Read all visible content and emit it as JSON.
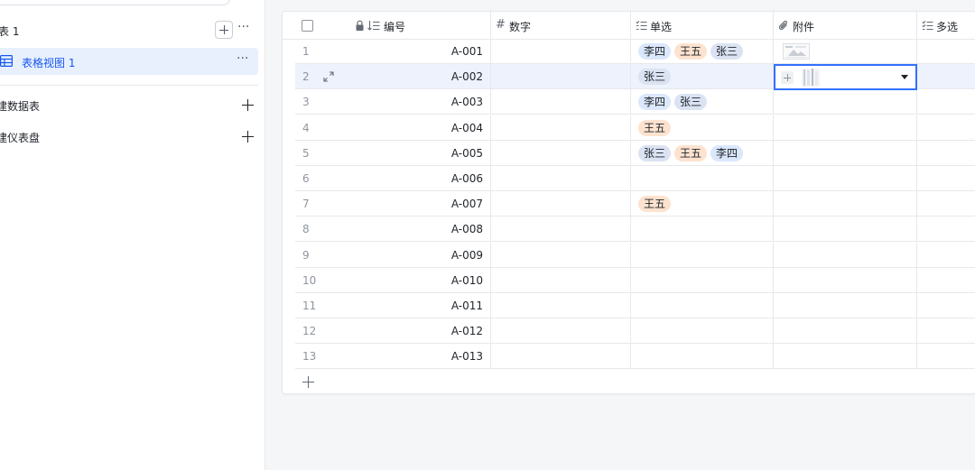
{
  "sidebar": {
    "table_label": "表 1",
    "more_glyph": "···",
    "view": {
      "label": "表格视图 1",
      "more_glyph": "···"
    },
    "actions": [
      {
        "label": "建数据表"
      },
      {
        "label": "建仪表盘"
      }
    ]
  },
  "grid": {
    "columns": [
      {
        "label": "编号",
        "icon": "lock-icon, sort-icon"
      },
      {
        "label": "数字",
        "icon": "hash-icon"
      },
      {
        "label": "单选",
        "icon": "single-select-icon"
      },
      {
        "label": "附件",
        "icon": "paperclip-icon"
      },
      {
        "label": "多选",
        "icon": "multi-select-icon"
      }
    ],
    "hash_glyph": "#",
    "rows": [
      {
        "num": "1",
        "code": "A-001",
        "tags": [
          "李四",
          "王五",
          "张三"
        ],
        "attachment": true
      },
      {
        "num": "2",
        "code": "A-002",
        "tags": [
          "张三"
        ],
        "selected": true
      },
      {
        "num": "3",
        "code": "A-003",
        "tags": [
          "李四",
          "张三"
        ]
      },
      {
        "num": "4",
        "code": "A-004",
        "tags": [
          "王五"
        ]
      },
      {
        "num": "5",
        "code": "A-005",
        "tags": [
          "张三",
          "王五",
          "李四"
        ]
      },
      {
        "num": "6",
        "code": "A-006",
        "tags": []
      },
      {
        "num": "7",
        "code": "A-007",
        "tags": [
          "王五"
        ]
      },
      {
        "num": "8",
        "code": "A-008",
        "tags": []
      },
      {
        "num": "9",
        "code": "A-009",
        "tags": []
      },
      {
        "num": "10",
        "code": "A-010",
        "tags": []
      },
      {
        "num": "11",
        "code": "A-011",
        "tags": []
      },
      {
        "num": "12",
        "code": "A-012",
        "tags": []
      },
      {
        "num": "13",
        "code": "A-013",
        "tags": []
      }
    ]
  },
  "colors": {
    "accent": "#1456f0",
    "selected_row": "#edf2fc",
    "tag_李四": "#dbe7fb",
    "tag_王五": "#fde3cf",
    "tag_张三": "#dbe3f3"
  }
}
